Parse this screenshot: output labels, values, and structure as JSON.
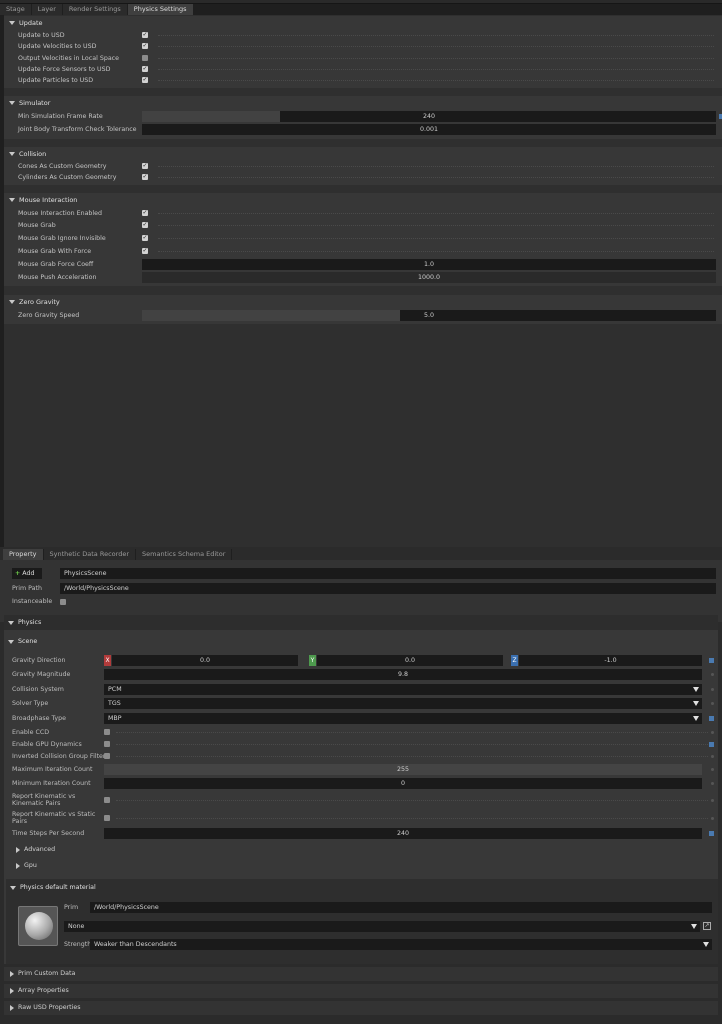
{
  "top_tabs": [
    "Stage",
    "Layer",
    "Render Settings",
    "Physics Settings"
  ],
  "settings": {
    "update": {
      "title": "Update",
      "rows": [
        {
          "label": "Update to USD",
          "checked": true
        },
        {
          "label": "Update Velocities to USD",
          "checked": true
        },
        {
          "label": "Output Velocities in Local Space",
          "checked": false
        },
        {
          "label": "Update Force Sensors to USD",
          "checked": true
        },
        {
          "label": "Update Particles to USD",
          "checked": true
        }
      ]
    },
    "simulator": {
      "title": "Simulator",
      "min_rate_label": "Min Simulation Frame Rate",
      "min_rate_value": "240",
      "tolerance_label": "Joint Body Transform Check Tolerance",
      "tolerance_value": "0.001"
    },
    "collision": {
      "title": "Collision",
      "rows": [
        {
          "label": "Cones As Custom Geometry",
          "checked": true
        },
        {
          "label": "Cylinders As Custom Geometry",
          "checked": true
        }
      ]
    },
    "mouse": {
      "title": "Mouse Interaction",
      "rows": [
        {
          "label": "Mouse Interaction Enabled",
          "checked": true
        },
        {
          "label": "Mouse Grab",
          "checked": true
        },
        {
          "label": "Mouse Grab Ignore Invisible",
          "checked": true
        },
        {
          "label": "Mouse Grab With Force",
          "checked": true
        }
      ],
      "force_coeff_label": "Mouse Grab Force Coeff",
      "force_coeff_value": "1.0",
      "push_label": "Mouse Push Acceleration",
      "push_value": "1000.0"
    },
    "zero_gravity": {
      "title": "Zero Gravity",
      "speed_label": "Zero Gravity Speed",
      "speed_value": "5.0",
      "speed_fraction": 0.45
    }
  },
  "bottom_tabs": [
    "Property",
    "Synthetic Data Recorder",
    "Semantics Schema Editor"
  ],
  "property": {
    "add_label": "Add",
    "name_value": "PhysicsScene",
    "prim_path_label": "Prim Path",
    "prim_path_value": "/World/PhysicsScene",
    "instanceable_label": "Instanceable",
    "physics_title": "Physics",
    "scene_title": "Scene",
    "gravity_direction_label": "Gravity Direction",
    "gx": "0.0",
    "gy": "0.0",
    "gz": "-1.0",
    "axis_x": "X",
    "axis_y": "Y",
    "axis_z": "Z",
    "gravity_magnitude_label": "Gravity Magnitude",
    "gravity_magnitude_value": "9.8",
    "collision_system_label": "Collision System",
    "collision_system_value": "PCM",
    "solver_type_label": "Solver Type",
    "solver_type_value": "TGS",
    "broadphase_label": "Broadphase Type",
    "broadphase_value": "MBP",
    "enable_ccd_label": "Enable CCD",
    "enable_gpu_label": "Enable GPU Dynamics",
    "inverted_label": "Inverted Collision Group Filter",
    "max_iter_label": "Maximum Iteration Count",
    "max_iter_value": "255",
    "min_iter_label": "Minimum Iteration Count",
    "min_iter_value": "0",
    "report_kk_label1": "Report Kinematic vs",
    "report_kk_label2": "Kinematic Pairs",
    "report_ks_label1": "Report Kinematic vs Static",
    "report_ks_label2": "Pairs",
    "time_steps_label": "Time Steps Per Second",
    "time_steps_value": "240",
    "advanced_label": "Advanced",
    "gpu_label": "Gpu",
    "material_title": "Physics default material",
    "mat_prim_label": "Prim",
    "mat_prim_value": "/World/PhysicsScene",
    "mat_none_value": "None",
    "strength_label": "Strength",
    "strength_value": "Weaker than Descendants",
    "prim_custom_data": "Prim Custom Data",
    "array_properties": "Array Properties",
    "raw_usd_properties": "Raw USD Properties"
  }
}
